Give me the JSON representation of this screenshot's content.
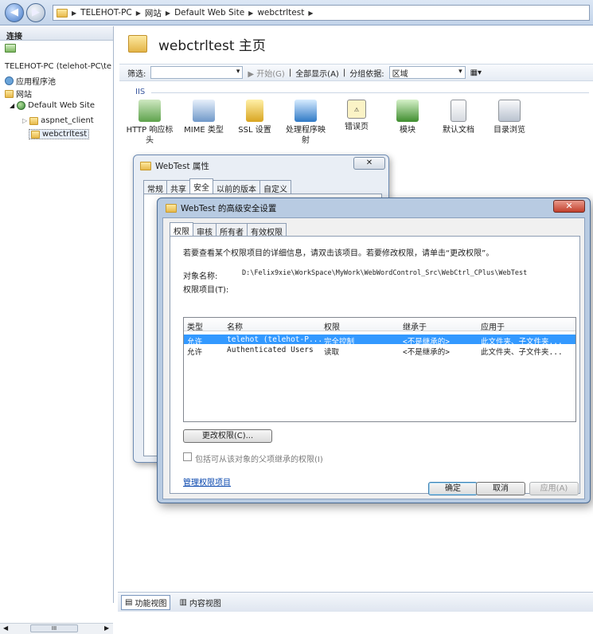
{
  "breadcrumb": {
    "items": [
      "TELEHOT-PC",
      "网站",
      "Default Web Site",
      "webctrltest"
    ]
  },
  "left_pane": {
    "header": "连接",
    "tree": [
      {
        "label": "TELEHOT-PC (telehot-PC\\te",
        "level": 0
      },
      {
        "label": "应用程序池",
        "level": 1
      },
      {
        "label": "网站",
        "level": 1
      },
      {
        "label": "Default Web Site",
        "level": 2
      },
      {
        "label": "aspnet_client",
        "level": 3
      },
      {
        "label": "webctrltest",
        "level": 3
      }
    ],
    "scroll_mid": "III"
  },
  "main": {
    "title": "webctrltest 主页",
    "filter": {
      "label": "筛选:",
      "start_label": "开始(G)",
      "show_all_label": "全部显示(A)",
      "group_label": "分组依据:",
      "group_value": "区域"
    },
    "section_label": "IIS",
    "features": [
      {
        "line1": "HTTP 响应标",
        "line2": "头"
      },
      {
        "line1": "MIME 类型",
        "line2": ""
      },
      {
        "line1": "SSL 设置",
        "line2": ""
      },
      {
        "line1": "处理程序映",
        "line2": "射"
      },
      {
        "line1": "错误页",
        "line2": ""
      },
      {
        "line1": "模块",
        "line2": ""
      },
      {
        "line1": "默认文档",
        "line2": ""
      },
      {
        "line1": "目录浏览",
        "line2": ""
      }
    ]
  },
  "bottom_tabs": {
    "features_view": "功能视图",
    "content_view": "内容视图"
  },
  "props_dialog": {
    "title": "WebTest 属性",
    "close_label": "✕",
    "tabs": [
      "常规",
      "共享",
      "安全",
      "以前的版本",
      "自定义"
    ]
  },
  "adv_dialog": {
    "title": "WebTest 的高级安全设置",
    "close_label": "✕",
    "tabs": [
      "权限",
      "审核",
      "所有者",
      "有效权限"
    ],
    "intro": "若要查看某个权限项目的详细信息，请双击该项目。若要修改权限，请单击“更改权限”。",
    "object_label": "对象名称:",
    "object_path": "D:\\Felix9xie\\WorkSpace\\MyWork\\WebWordControl_Src\\WebCtrl_CPlus\\WebTest",
    "entries_label": "权限项目(T):",
    "columns": [
      "类型",
      "名称",
      "权限",
      "继承于",
      "应用于"
    ],
    "rows": [
      {
        "type": "允许",
        "name": "telehot (telehot-P...",
        "perm": "完全控制",
        "inherit": "<不是继承的>",
        "apply": "此文件夹、子文件夹..."
      },
      {
        "type": "允许",
        "name": "Authenticated Users",
        "perm": "读取",
        "inherit": "<不是继承的>",
        "apply": "此文件夹、子文件夹..."
      }
    ],
    "change_button": "更改权限(C)...",
    "inherit_checkbox": "包括可从该对象的父项继承的权限(I)",
    "manage_link": "管理权限项目",
    "ok": "确定",
    "cancel": "取消",
    "apply": "应用(A)"
  }
}
